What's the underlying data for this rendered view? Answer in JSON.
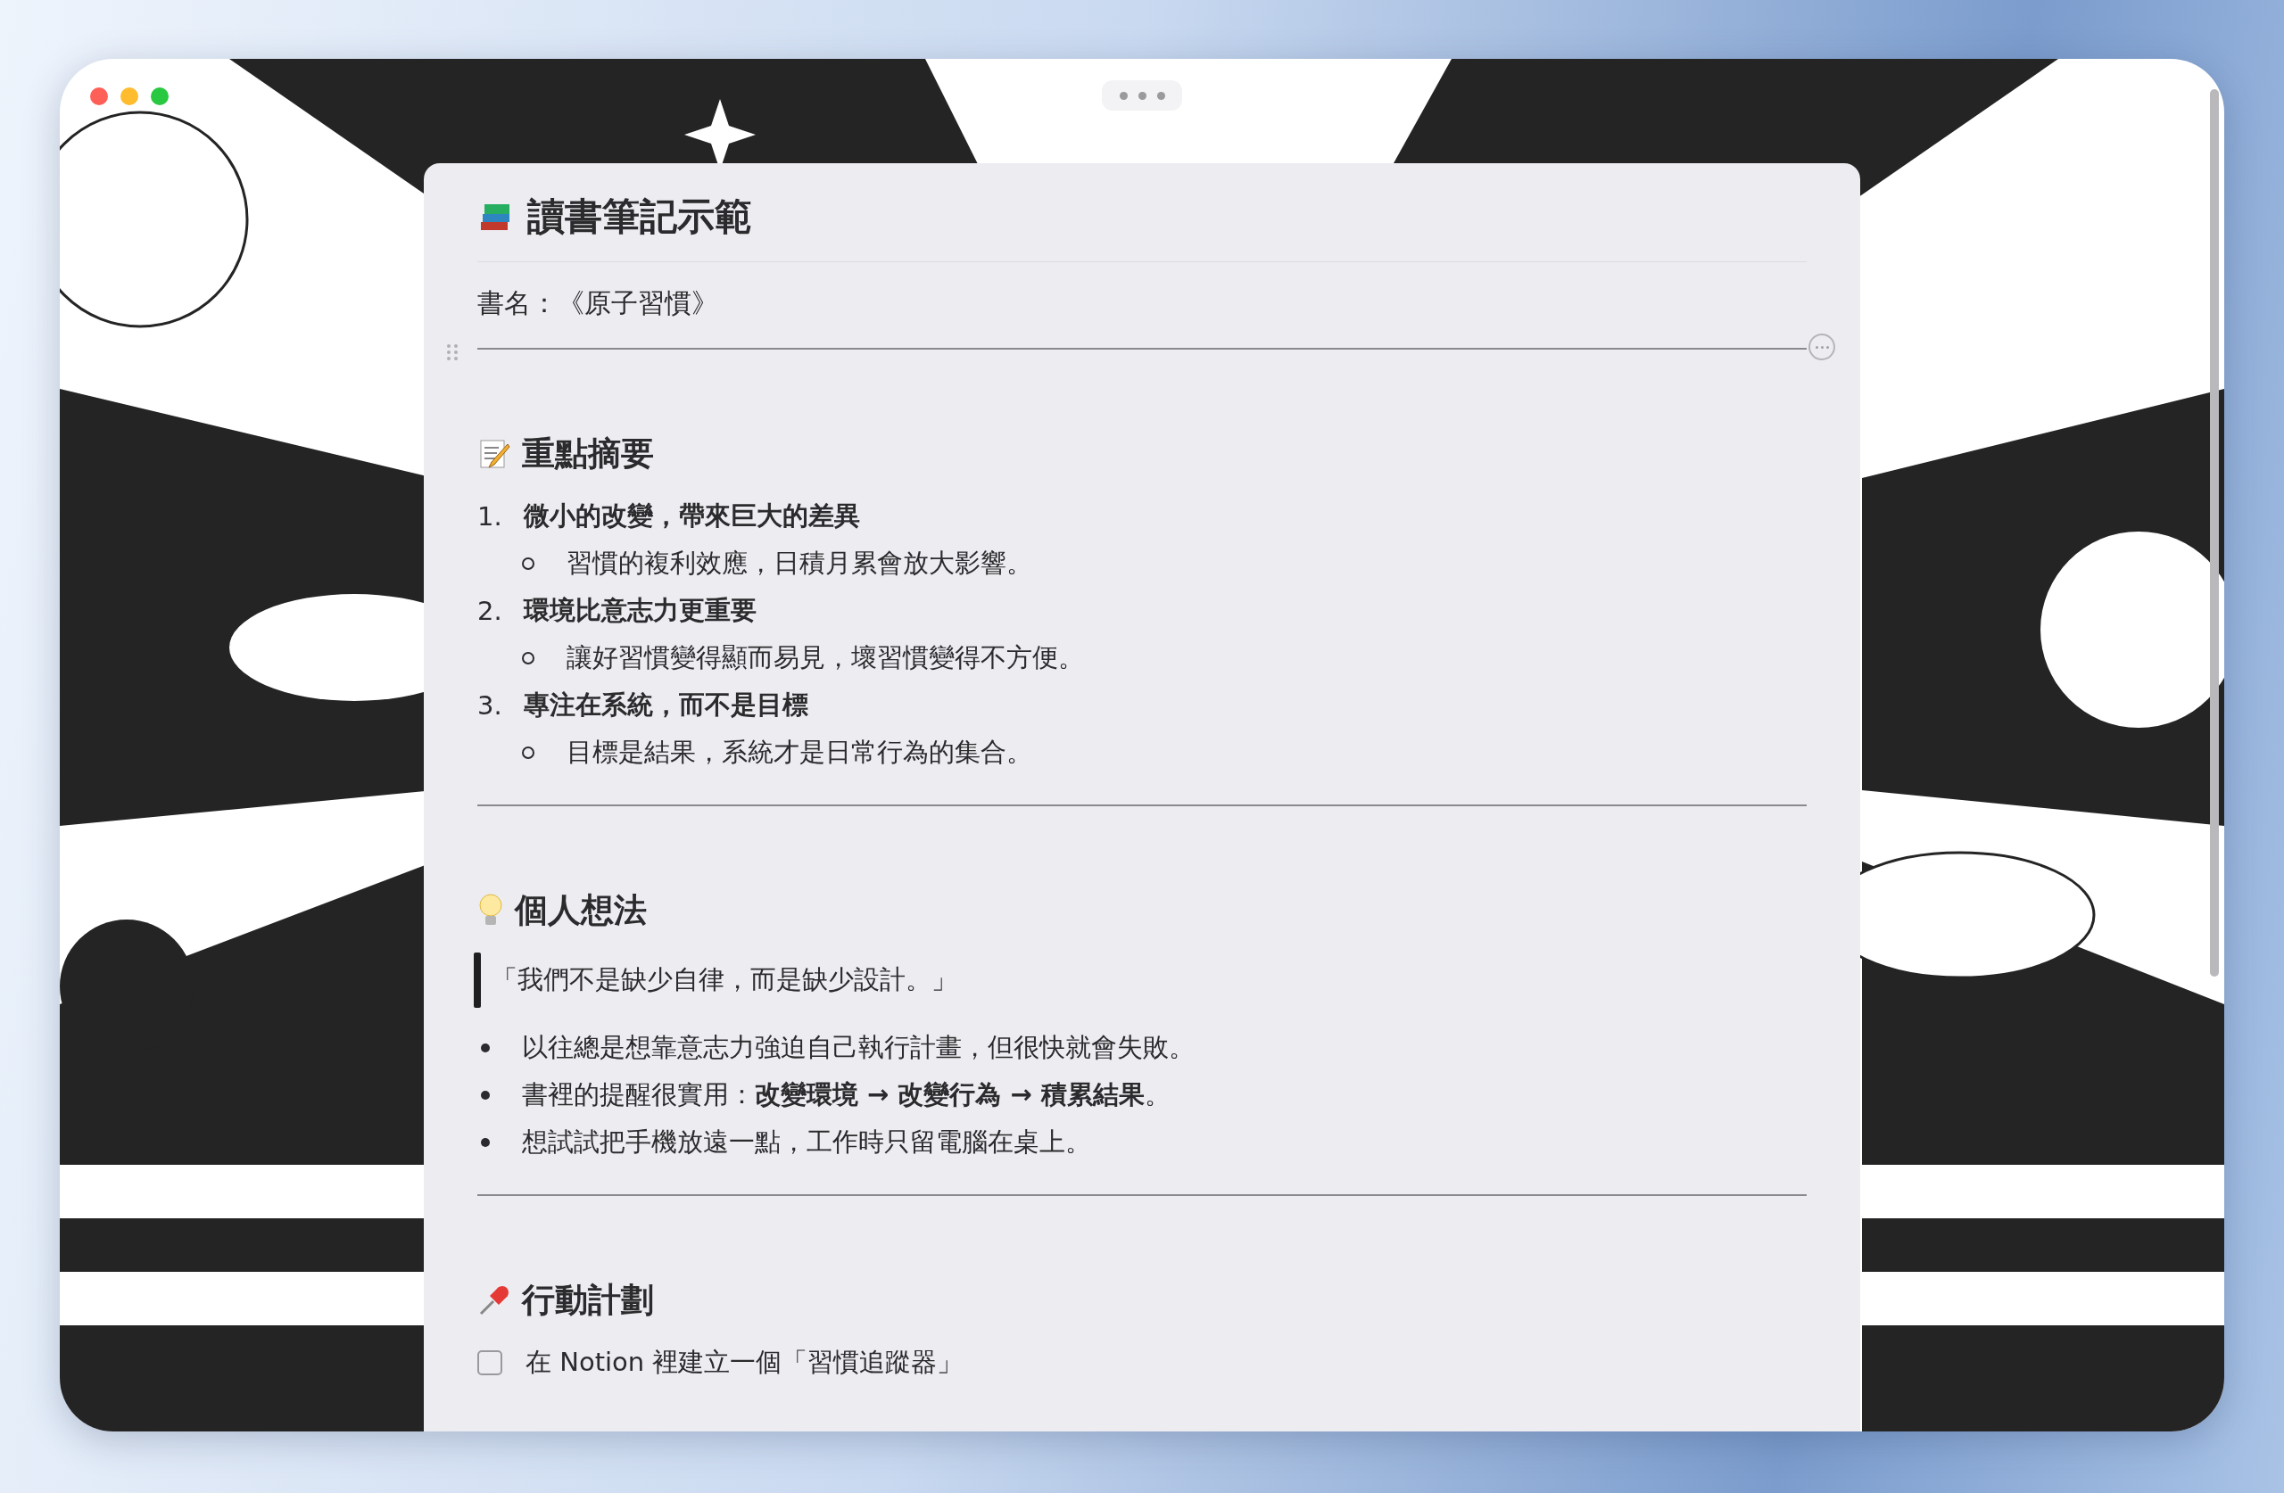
{
  "page": {
    "title": "讀書筆記示範",
    "book_line": "書名：《原子習慣》"
  },
  "sections": [
    {
      "heading": "重點摘要",
      "blocks": [
        {
          "kind": "numbered",
          "items": [
            {
              "number": "1.",
              "text": "微小的改變，帶來巨大的差異",
              "children": [
                {
                  "text": "習慣的複利效應，日積月累會放大影響。"
                }
              ]
            },
            {
              "number": "2.",
              "text": "環境比意志力更重要",
              "children": [
                {
                  "text": "讓好習慣變得顯而易見，壞習慣變得不方便。"
                }
              ]
            },
            {
              "number": "3.",
              "text": "專注在系統，而不是目標",
              "children": [
                {
                  "text": "目標是結果，系統才是日常行為的集合。"
                }
              ]
            }
          ]
        }
      ]
    },
    {
      "heading": "個人想法",
      "blocks": [
        {
          "kind": "quote",
          "text": "「我們不是缺少自律，而是缺少設計。」"
        },
        {
          "kind": "bulleted",
          "items": [
            {
              "text": "以往總是想靠意志力強迫自己執行計畫，但很快就會失敗。"
            },
            {
              "text": "書裡的提醒很實用：**改變環境 → 改變行為 → 積累結果**。"
            },
            {
              "text": "想試試把手機放遠一點，工作時只留電腦在桌上。"
            }
          ]
        }
      ]
    },
    {
      "heading": "行動計劃",
      "blocks": [
        {
          "kind": "todo",
          "items": [
            {
              "text": "在 Notion 裡建立一個「習慣追蹤器」",
              "checked": false
            }
          ]
        }
      ]
    }
  ]
}
